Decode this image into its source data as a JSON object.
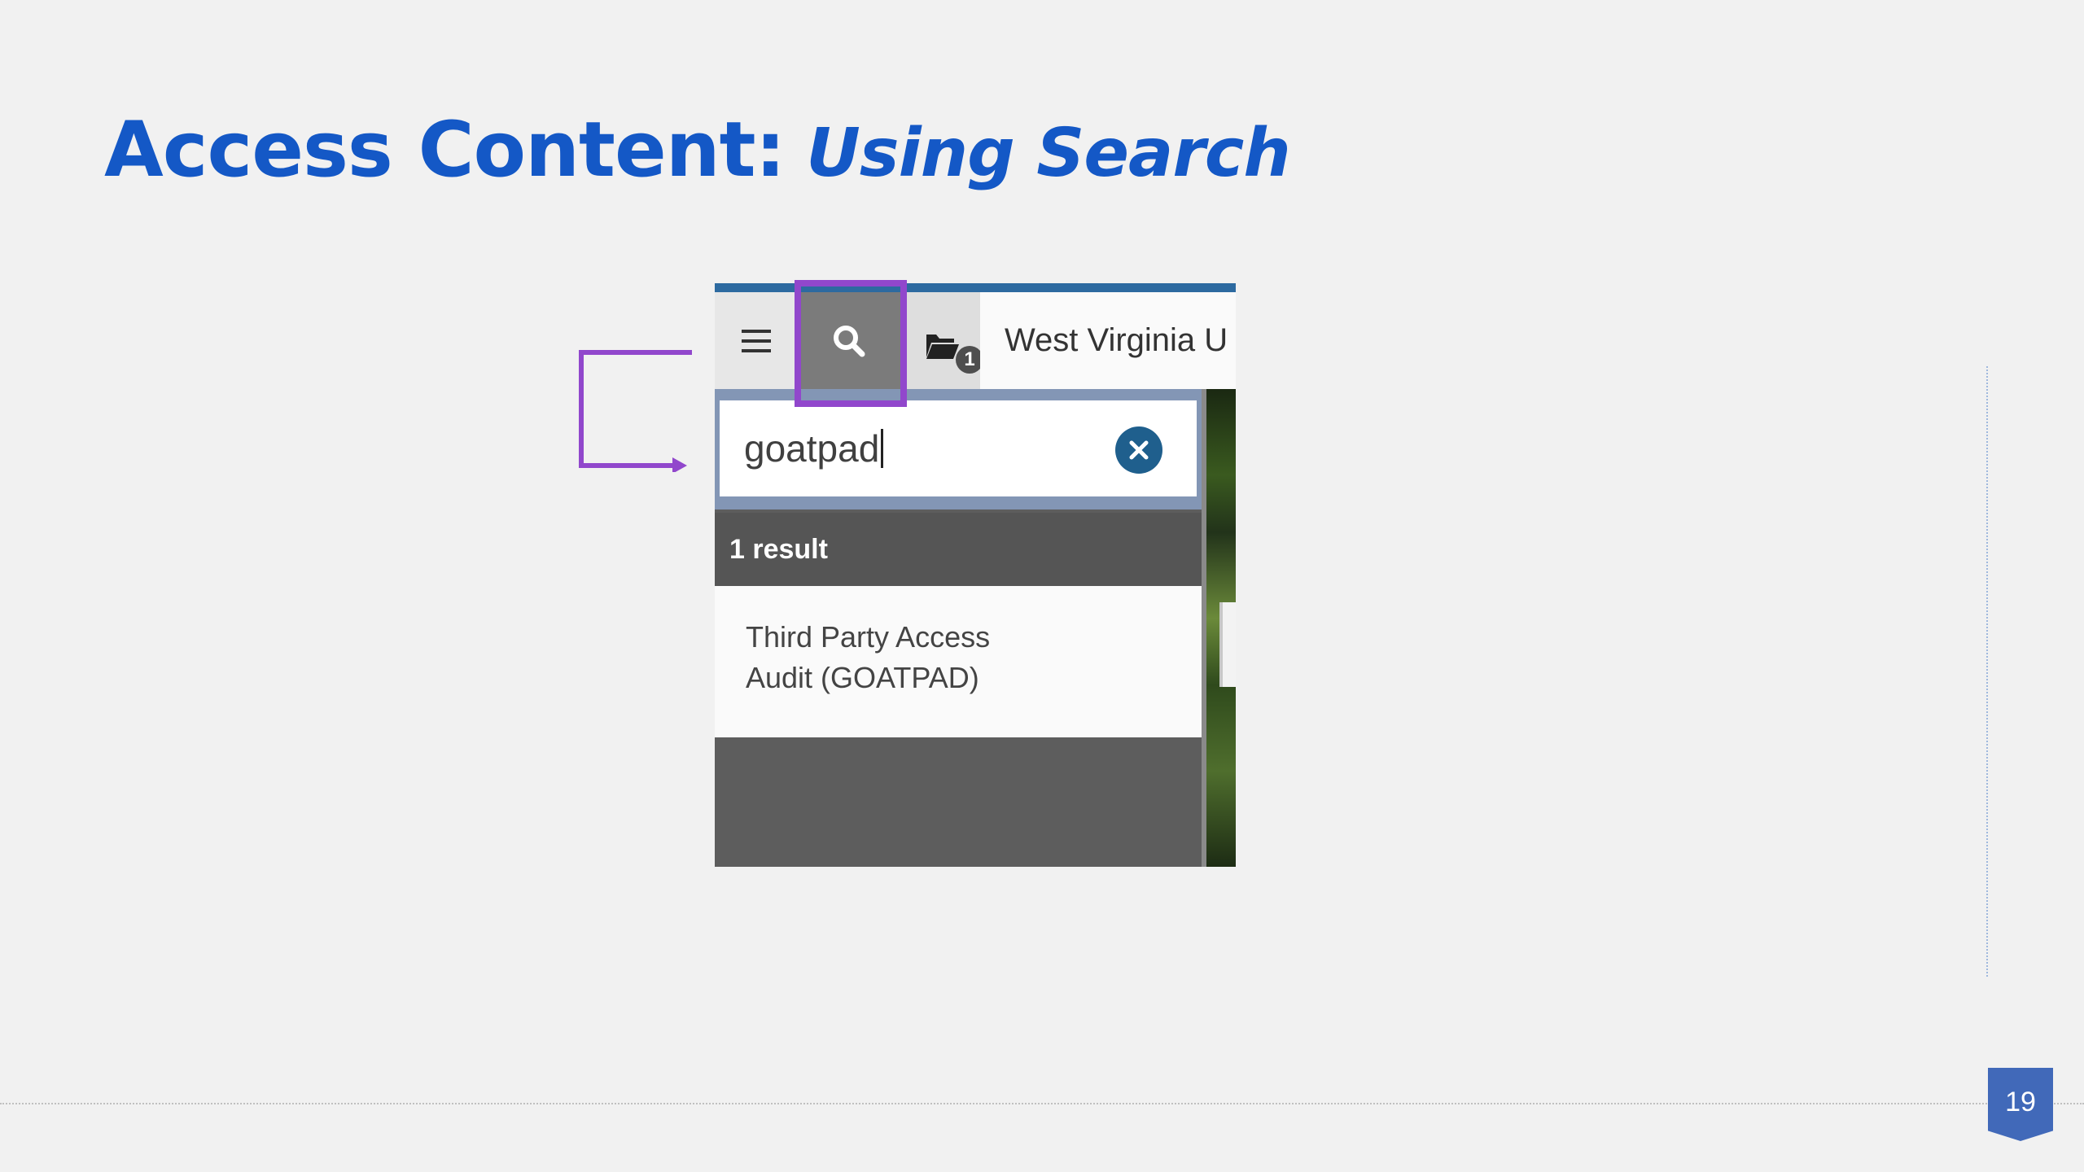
{
  "slide": {
    "title_main": "Access Content:",
    "title_sub": "Using Search",
    "page_number": "19"
  },
  "screenshot": {
    "nav": {
      "menu_icon": "hamburger-icon",
      "search_icon": "magnifier-icon",
      "folder_icon": "folders-icon",
      "folder_badge": "1",
      "institution_label": "West Virginia U"
    },
    "search": {
      "value": "goatpad",
      "clear_icon": "clear-x-icon"
    },
    "results": {
      "count_label": "1 result",
      "items": [
        {
          "line1": "Third Party Access",
          "line2": "Audit (GOATPAD)"
        }
      ]
    }
  },
  "colors": {
    "title": "#1458c6",
    "highlight": "#9147cc",
    "page_badge": "#4169b9"
  }
}
